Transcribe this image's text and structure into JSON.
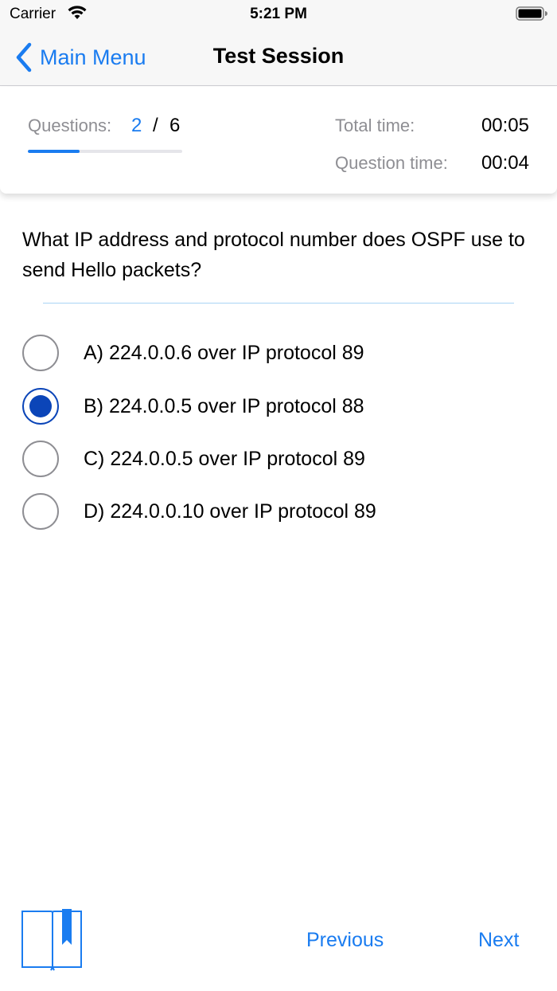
{
  "status_bar": {
    "carrier": "Carrier",
    "time": "5:21 PM"
  },
  "nav": {
    "back_label": "Main Menu",
    "title": "Test Session"
  },
  "stats": {
    "questions_label": "Questions:",
    "current_question": "2",
    "separator": "/",
    "total_questions": "6",
    "progress_fraction": 0.333,
    "total_time_label": "Total time:",
    "total_time_value": "00:05",
    "question_time_label": "Question time:",
    "question_time_value": "00:04"
  },
  "question": {
    "text": "What IP address and protocol number does OSPF use to send Hello packets?"
  },
  "options": [
    {
      "label": "A) 224.0.0.6 over IP protocol 89",
      "selected": false
    },
    {
      "label": "B) 224.0.0.5 over IP protocol 88",
      "selected": true
    },
    {
      "label": "C) 224.0.0.5 over IP protocol 89",
      "selected": false
    },
    {
      "label": "D) 224.0.0.10 over IP protocol 89",
      "selected": false
    }
  ],
  "toolbar": {
    "bookmark_icon": "book-bookmark-icon",
    "previous_label": "Previous",
    "next_label": "Next"
  },
  "colors": {
    "accent": "#1a7cf0",
    "selected_radio": "#0b45b8",
    "divider": "#a9d4f5",
    "secondary_text": "#8e8e93"
  }
}
